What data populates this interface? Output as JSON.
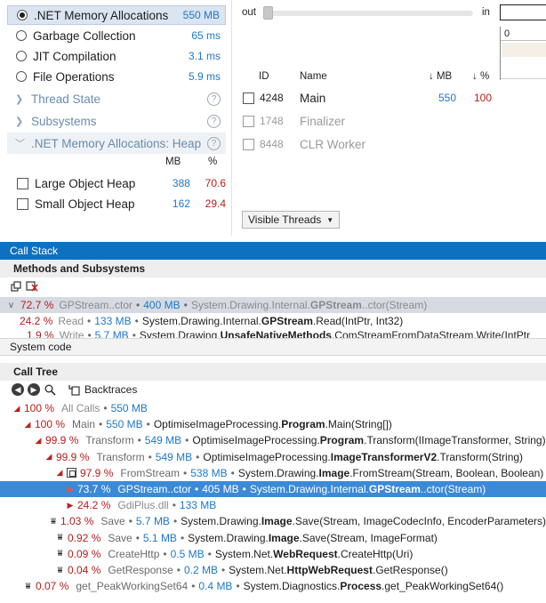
{
  "left_panel": {
    "categories": [
      {
        "label": ".NET Memory Allocations",
        "value": "550 MB",
        "selected": true
      },
      {
        "label": "Garbage Collection",
        "value": "65 ms",
        "selected": false
      },
      {
        "label": "JIT Compilation",
        "value": "3.1 ms",
        "selected": false
      },
      {
        "label": "File Operations",
        "value": "5.9 ms",
        "selected": false
      }
    ],
    "sections": [
      {
        "label": "Thread State",
        "expanded": false
      },
      {
        "label": "Subsystems",
        "expanded": false
      },
      {
        "label": ".NET Memory Allocations: Heap",
        "expanded": true
      }
    ],
    "heap_columns": {
      "mb": "MB",
      "pct": "%"
    },
    "heaps": [
      {
        "label": "Large Object Heap",
        "mb": "388",
        "pct": "70.6"
      },
      {
        "label": "Small Object Heap",
        "mb": "162",
        "pct": "29.4"
      }
    ]
  },
  "right_panel": {
    "slider": {
      "out_label": "out",
      "in_label": "in"
    },
    "timeline_start": "0",
    "thread_columns": {
      "id": "ID",
      "name": "Name",
      "mb": "↓ MB",
      "pct": "↓ %"
    },
    "threads": [
      {
        "id": "4248",
        "name": "Main",
        "mb": "550",
        "pct": "100",
        "dim": false
      },
      {
        "id": "1748",
        "name": "Finalizer",
        "mb": "",
        "pct": "",
        "dim": true
      },
      {
        "id": "8448",
        "name": "CLR Worker",
        "mb": "",
        "pct": "",
        "dim": true
      }
    ],
    "visible_threads_label": "Visible Threads"
  },
  "call_stack": {
    "title": "Call Stack",
    "methods_title": "Methods and Subsystems",
    "rows": [
      {
        "chev": "v",
        "pct": "72.7 %",
        "name": "GPStream..ctor",
        "mb": "400 MB",
        "ns": "System.Drawing.Internal.",
        "cls": "GPStream",
        "method": "..ctor(Stream)",
        "highlight": true
      },
      {
        "chev": "",
        "pct": "24.2 %",
        "name": "Read",
        "mb": "133 MB",
        "ns": "System.Drawing.Internal.",
        "cls": "GPStream",
        "method": ".Read(IntPtr, Int32)",
        "highlight": false
      },
      {
        "chev": "",
        "pct": "1.9 %",
        "name": "Write",
        "mb": "5.7 MB",
        "ns": "System.Drawing.",
        "cls": "UnsafeNativeMethods",
        "method": ".ComStreamFromDataStream.Write(IntPtr",
        "highlight": false
      }
    ],
    "system_code_label": "System code"
  },
  "call_tree": {
    "title": "Call Tree",
    "backtraces_label": "Backtraces",
    "rows": [
      {
        "indent": 0,
        "icon": "tri-down",
        "pct": "100 %",
        "name": "All Calls",
        "mb": "550 MB",
        "ns": "",
        "cls": "",
        "method": "",
        "selected": false,
        "gray_name": true
      },
      {
        "indent": 1,
        "icon": "tri-down",
        "pct": "100 %",
        "name": "Main",
        "mb": "550 MB",
        "ns": "OptimiseImageProcessing.",
        "cls": "Program",
        "method": ".Main(String[])",
        "selected": false
      },
      {
        "indent": 2,
        "icon": "tri-down",
        "pct": "99.9 %",
        "name": "Transform",
        "mb": "549 MB",
        "ns": "OptimiseImageProcessing.",
        "cls": "Program",
        "method": ".Transform(IImageTransformer, String)",
        "selected": false
      },
      {
        "indent": 3,
        "icon": "tri-down",
        "pct": "99.9 %",
        "name": "Transform",
        "mb": "549 MB",
        "ns": "OptimiseImageProcessing.",
        "cls": "ImageTransformerV2",
        "method": ".Transform(String)",
        "selected": false
      },
      {
        "indent": 4,
        "icon": "tri-down-file",
        "pct": "97.9 %",
        "name": "FromStream",
        "mb": "538 MB",
        "ns": "System.Drawing.",
        "cls": "Image",
        "method": ".FromStream(Stream, Boolean, Boolean)",
        "selected": false
      },
      {
        "indent": 5,
        "icon": "tri-right",
        "pct": "73.7 %",
        "name": "GPStream..ctor",
        "mb": "405 MB",
        "ns": "System.Drawing.Internal.",
        "cls": "GPStream",
        "method": "..ctor(Stream)",
        "selected": true
      },
      {
        "indent": 5,
        "icon": "tri-right",
        "pct": "24.2 %",
        "name": "GdiPlus.dll",
        "mb": "133 MB",
        "ns": "",
        "cls": "",
        "method": "",
        "selected": false,
        "gray_name": true
      },
      {
        "indent": 4,
        "icon": "leaf",
        "pct": "1.03 %",
        "name": "Save",
        "mb": "5.7 MB",
        "ns": "System.Drawing.",
        "cls": "Image",
        "method": ".Save(Stream, ImageCodecInfo, EncoderParameters)",
        "selected": false
      },
      {
        "indent": 4,
        "icon": "leaf",
        "pct": "0.92 %",
        "name": "Save",
        "mb": "5.1 MB",
        "ns": "System.Drawing.",
        "cls": "Image",
        "method": ".Save(Stream, ImageFormat)",
        "selected": false
      },
      {
        "indent": 4,
        "icon": "leaf",
        "pct": "0.09 %",
        "name": "CreateHttp",
        "mb": "0.5 MB",
        "ns": "System.Net.",
        "cls": "WebRequest",
        "method": ".CreateHttp(Uri)",
        "selected": false
      },
      {
        "indent": 4,
        "icon": "leaf",
        "pct": "0.04 %",
        "name": "GetResponse",
        "mb": "0.2 MB",
        "ns": "System.Net.",
        "cls": "HttpWebRequest",
        "method": ".GetResponse()",
        "selected": false
      },
      {
        "indent": 1,
        "icon": "leaf",
        "pct": "0.07 %",
        "name": "get_PeakWorkingSet64",
        "mb": "0.4 MB",
        "ns": "System.Diagnostics.",
        "cls": "Process",
        "method": ".get_PeakWorkingSet64()",
        "selected": false
      }
    ]
  },
  "colors": {
    "accent_blue": "#0e71c0",
    "selection_blue": "#3b8ad8",
    "value_blue": "#1e78c8",
    "percent_red": "#b3201d"
  }
}
